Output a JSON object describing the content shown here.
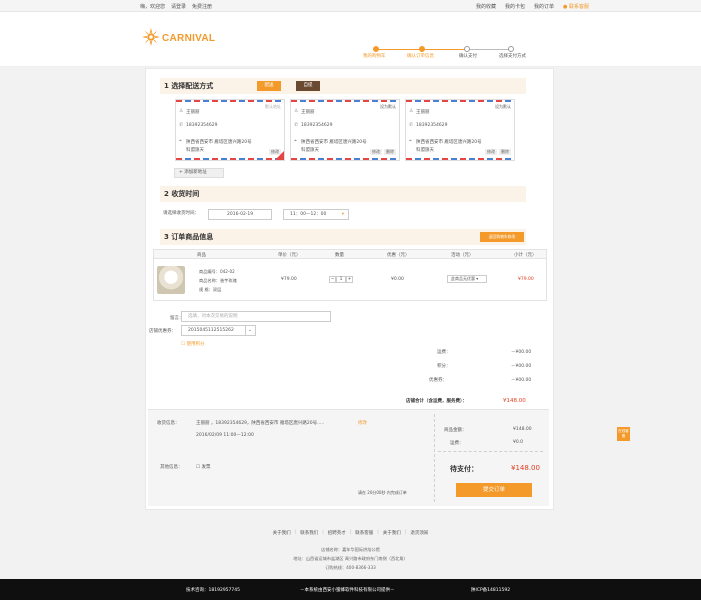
{
  "topbar": {
    "left": [
      "嗨，欢迎您",
      "请登录",
      "免费注册"
    ],
    "right": [
      "我的收藏",
      "我的卡包",
      "我的订单"
    ],
    "contact_label": "联系客服"
  },
  "brand": {
    "logo_text": "CARNIVAL",
    "accent": "#f39a2b",
    "brown": "#6b4a32"
  },
  "steps": [
    {
      "label": "我的购物车",
      "active": true
    },
    {
      "label": "确认订单信息",
      "active": true
    },
    {
      "label": "确认支付",
      "active": false
    },
    {
      "label": "选择支付方式",
      "active": false
    }
  ],
  "section1": {
    "number": "1",
    "title": "选择配送方式",
    "delivery_label": "配送",
    "pickup_label": "自提",
    "addresses": [
      {
        "name": "王丽丽",
        "phone": "18392354629",
        "address": "陕西省西安市  雁塔区唐兴路20号",
        "note": "科盟旗天",
        "tag": "默认地址",
        "selected": true,
        "ops": [
          "修改"
        ]
      },
      {
        "name": "王丽丽",
        "phone": "18392354629",
        "address": "陕西省西安市  雁塔区唐兴路20号",
        "note": "科盟旗天",
        "tag": "设为默认",
        "selected": false,
        "ops": [
          "修改",
          "删除"
        ]
      },
      {
        "name": "王丽丽",
        "phone": "18392354629",
        "address": "陕西省西安市  雁塔区唐兴路20号",
        "note": "科盟旗天",
        "tag": "设为默认",
        "selected": false,
        "ops": [
          "修改",
          "删除"
        ]
      }
    ],
    "add_address_label": "+ 添加新地址"
  },
  "section2": {
    "number": "2",
    "title": "收货时间",
    "prompt": "请选择收货时间：",
    "date": "2016-02-19",
    "time": "11：00—12：00"
  },
  "section3": {
    "number": "3",
    "title": "订单商品信息",
    "back_label": "返回购物车修改",
    "columns": [
      "商品",
      "单价（元）",
      "数量",
      "优惠（元）",
      "活动（元）",
      "小计（元）"
    ],
    "item": {
      "code": "商品编号：042-02",
      "name": "商品名称：香芋玫瑰",
      "spec": "规    格：双层",
      "price": "¥79.00",
      "qty": "1",
      "discount": "¥0.00",
      "promo": "此商品无优惠 ▾",
      "subtotal": "¥79.00"
    },
    "remark_label": "留言：",
    "remark_placeholder": "选填，对本次交易的说明",
    "coupon_label": "店铺优惠券：",
    "coupon_value": "2015045112515262",
    "use_points_label": "使用积分"
  },
  "summary": {
    "rows": [
      {
        "label": "运费：",
        "value": "－¥00.00"
      },
      {
        "label": "积分：",
        "value": "－¥00.00"
      },
      {
        "label": "优惠券：",
        "value": "－¥00.00"
      }
    ],
    "total_label": "店铺合计（含运费，服务费）：",
    "total_value": "¥148.00"
  },
  "confirm": {
    "receiver_label": "收货信息：",
    "receiver_value": "王丽丽 ，18392354629，陕西省西安市  雁塔区唐兴路20号.....",
    "edit_label": "修改",
    "time_value": "2016/02/09    11:00—12:00",
    "other_label": "其他信息：",
    "invoice_label": "发票",
    "goods_amount_label": "商品金额：",
    "goods_amount": "¥148.00",
    "shipping_label": "运费：",
    "shipping": "¥0.0",
    "pay_label": "待支付：",
    "pay_value": "¥148.00",
    "deadline": "请在 20分00秒 内完成订单",
    "submit_label": "提交订单"
  },
  "side_tab": "在线客服",
  "footer": {
    "links": [
      "关于我们",
      "联系我们",
      "招聘英才",
      "联系客服",
      "关于我们",
      "退货须知"
    ],
    "shop_name": "店铺名称：嘉年华国际烘焙公馆",
    "address": "地址：山西省运城市盐湖区  禹兴路市政府东门南侧（西北角）",
    "phone": "订购热线：400-8366-333"
  },
  "bottombar": {
    "hotline": "技术咨询：18192957745",
    "copyright": "－本系统由西安小蜜蜂软件科技有限公司提供－",
    "icp": "陕ICP备14811592"
  }
}
